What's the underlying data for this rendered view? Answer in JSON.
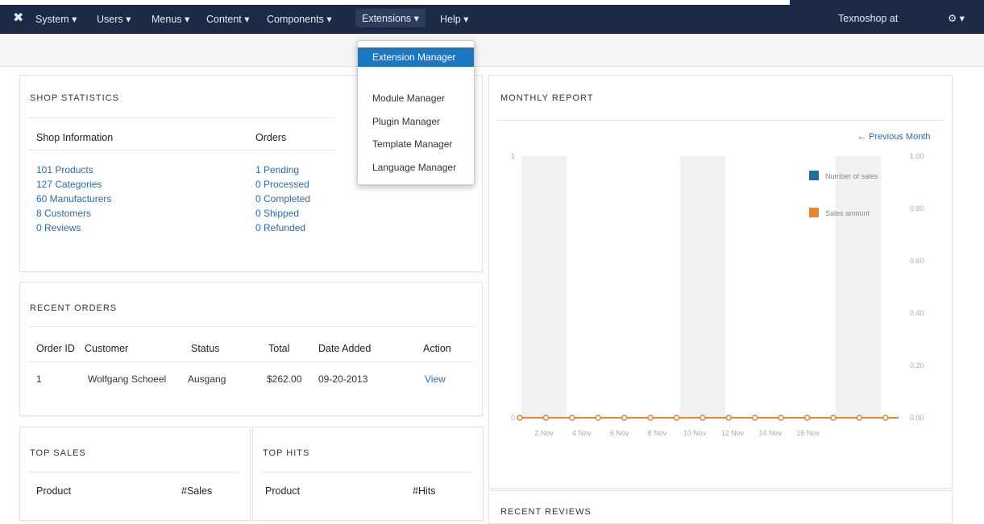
{
  "navbar": {
    "menus": [
      "System ▾",
      "Users ▾",
      "Menus ▾",
      "Content ▾",
      "Components ▾",
      "Extensions ▾",
      "Help ▾"
    ],
    "user": "Texnoshop at",
    "gear": "⚙ ▾"
  },
  "extensions_menu": {
    "items": [
      "Extension Manager",
      "Module Manager",
      "Plugin Manager",
      "Template Manager",
      "Language Manager"
    ]
  },
  "shop_statistics": {
    "title": "SHOP STATISTICS",
    "info_heading": "Shop Information",
    "orders_heading": "Orders",
    "info": [
      "101 Products",
      "127 Categories",
      "60 Manufacturers",
      "8 Customers",
      "0 Reviews"
    ],
    "orders": [
      "1 Pending",
      "0 Processed",
      "0 Completed",
      "0 Shipped",
      "0 Refunded"
    ]
  },
  "recent_orders": {
    "title": "RECENT ORDERS",
    "columns": [
      "Order ID",
      "Customer",
      "Status",
      "Total",
      "Date Added",
      "Action"
    ],
    "rows": [
      [
        "1",
        "Wolfgang Schoeel",
        "Ausgang",
        "$262.00",
        "09-20-2013",
        "View"
      ]
    ]
  },
  "top_sales": {
    "title": "TOP SALES",
    "col1": "Product",
    "col2": "#Sales"
  },
  "top_hits": {
    "title": "TOP HITS",
    "col1": "Product",
    "col2": "#Hits"
  },
  "monthly_report": {
    "title": "MONTHLY REPORT",
    "prev_link": "← Previous Month"
  },
  "recent_reviews": {
    "title": "RECENT REVIEWS"
  },
  "chart_data": {
    "type": "line",
    "x": [
      "2 Nov",
      "4 Nov",
      "6 Nov",
      "8 Nov",
      "10 Nov",
      "12 Nov",
      "14 Nov",
      "16 Nov"
    ],
    "series": [
      {
        "name": "Number of sales",
        "color": "#1f6f96",
        "values": [
          0,
          0,
          0,
          0,
          0,
          0,
          0,
          0,
          0,
          0,
          0,
          0,
          0,
          0,
          0,
          0,
          0,
          0,
          0,
          0,
          0,
          0,
          0,
          0,
          0,
          0,
          0,
          0,
          0,
          0
        ]
      },
      {
        "name": "Sales amount",
        "color": "#e8842c",
        "values": [
          0,
          0,
          0,
          0,
          0,
          0,
          0,
          0,
          0,
          0,
          0,
          0,
          0,
          0,
          0,
          0,
          0,
          0,
          0,
          0,
          0,
          0,
          0,
          0,
          0,
          0,
          0,
          0,
          0,
          0
        ]
      }
    ],
    "y_left": {
      "ticks": [
        "0",
        "1"
      ],
      "ylim": [
        0,
        1
      ]
    },
    "y_right": {
      "ticks": [
        "1.00",
        "0.80",
        "0.60",
        "0.40",
        "0.20",
        "0.00"
      ],
      "ylim": [
        0,
        1
      ]
    },
    "legend": "top-right"
  }
}
